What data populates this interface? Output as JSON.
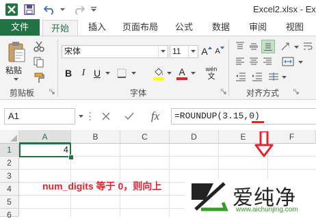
{
  "window": {
    "title": "Excel2.xlsx - Exce"
  },
  "quick_access": {
    "app_icon": "excel-logo-icon",
    "save_icon": "save-icon",
    "undo_icon": "undo-icon",
    "redo_icon": "redo-icon",
    "customize_icon": "qat-dropdown-icon"
  },
  "tabs": [
    "文件",
    "开始",
    "插入",
    "页面布局",
    "公式",
    "数据",
    "审阅",
    "视图"
  ],
  "active_tab": "开始",
  "ribbon": {
    "clipboard": {
      "group_label": "剪贴板",
      "paste_label": "粘贴"
    },
    "font": {
      "group_label": "字体",
      "font_name": "宋体",
      "font_size": "11",
      "grow_font": "A",
      "shrink_font": "A",
      "bold": "B",
      "italic": "I",
      "underline": "U",
      "font_color_glyph": "A",
      "phonetic_glyph": "wén",
      "phonetic_sub": "文"
    },
    "alignment": {
      "group_label": "对齐方式"
    }
  },
  "formula_bar": {
    "name_box": "A1",
    "cancel_icon": "cancel-x-icon",
    "enter_icon": "enter-check-icon",
    "fx_label": "fx",
    "formula": "=ROUNDUP(3.15,0)"
  },
  "sheet": {
    "columns": [
      "A",
      "B",
      "C",
      "D",
      "E",
      "F"
    ],
    "rows": [
      "1",
      "2",
      "3",
      "4",
      "5",
      "6"
    ],
    "selected_cell": "A1",
    "cells": {
      "A1": "4"
    }
  },
  "annotation": {
    "text": "num_digits 等于 0，则向上",
    "arrow_color": "#e8222d"
  },
  "watermark": {
    "text": "爱纯净",
    "url": "www.aichunjing.com"
  },
  "colors": {
    "excel_green": "#217346",
    "annotation_red": "#e8222d"
  }
}
